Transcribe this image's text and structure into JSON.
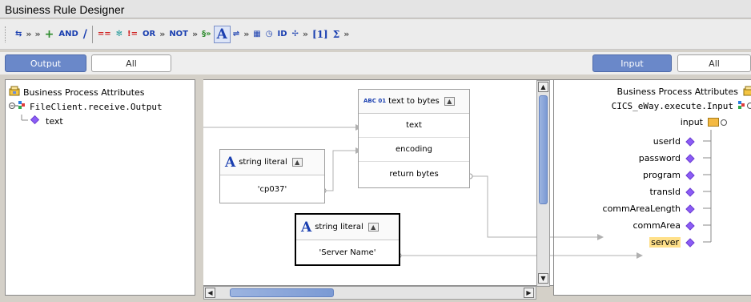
{
  "window": {
    "title": "Business Rule Designer"
  },
  "toolbar": {
    "items": [
      {
        "name": "mapping-icon",
        "label": "⇆"
      },
      {
        "name": "more-chevron",
        "label": "»"
      },
      {
        "name": "more-chevron",
        "label": "»"
      },
      {
        "name": "add-icon",
        "label": "+"
      },
      {
        "name": "and-button",
        "label": "AND"
      },
      {
        "name": "divide-icon",
        "label": "/"
      },
      {
        "name": "sep",
        "label": ""
      },
      {
        "name": "equals-icon",
        "label": "=="
      },
      {
        "name": "asterisk-icon",
        "label": "✻"
      },
      {
        "name": "not-equals-icon",
        "label": "!="
      },
      {
        "name": "or-button",
        "label": "OR"
      },
      {
        "name": "more-chevron",
        "label": "»"
      },
      {
        "name": "not-button",
        "label": "NOT"
      },
      {
        "name": "more-chevron",
        "label": "»"
      },
      {
        "name": "string-func-icon",
        "label": "§»"
      },
      {
        "name": "string-literal-icon",
        "label": "A"
      },
      {
        "name": "link-icon",
        "label": "⇌"
      },
      {
        "name": "more-chevron",
        "label": "»"
      },
      {
        "name": "calendar-icon",
        "label": "▦"
      },
      {
        "name": "clock-icon",
        "label": "◷"
      },
      {
        "name": "id-icon",
        "label": "ID"
      },
      {
        "name": "branch-icon",
        "label": "✢"
      },
      {
        "name": "more-chevron",
        "label": "»"
      },
      {
        "name": "array-icon",
        "label": "[1]"
      },
      {
        "name": "sum-icon",
        "label": "Σ"
      },
      {
        "name": "more-chevron",
        "label": "»"
      }
    ]
  },
  "left_tabs": {
    "active": "Output",
    "inactive": "All"
  },
  "right_tabs": {
    "active": "Input",
    "inactive": "All"
  },
  "left_tree": {
    "root": "Business Process Attributes",
    "child": "FileClient.receive.Output",
    "leaf": "text"
  },
  "canvas": {
    "text_to_bytes": {
      "title": "text to bytes",
      "icon_label": "ABC 01",
      "rows": [
        "text",
        "encoding",
        "return bytes"
      ]
    },
    "literal_1": {
      "title": "string literal",
      "value": "'cp037'"
    },
    "literal_2": {
      "title": "string literal",
      "value": "'Server Name'"
    }
  },
  "right_tree": {
    "root": "Business Process Attributes",
    "child": "CICS_eWay.execute.Input",
    "input_node": "input",
    "fields": [
      "userId",
      "password",
      "program",
      "transId",
      "commAreaLength",
      "commArea",
      "server"
    ]
  },
  "colors": {
    "accent": "#6a88c9",
    "diamond": "#8b5cf6",
    "highlight": "#ffe08a"
  }
}
